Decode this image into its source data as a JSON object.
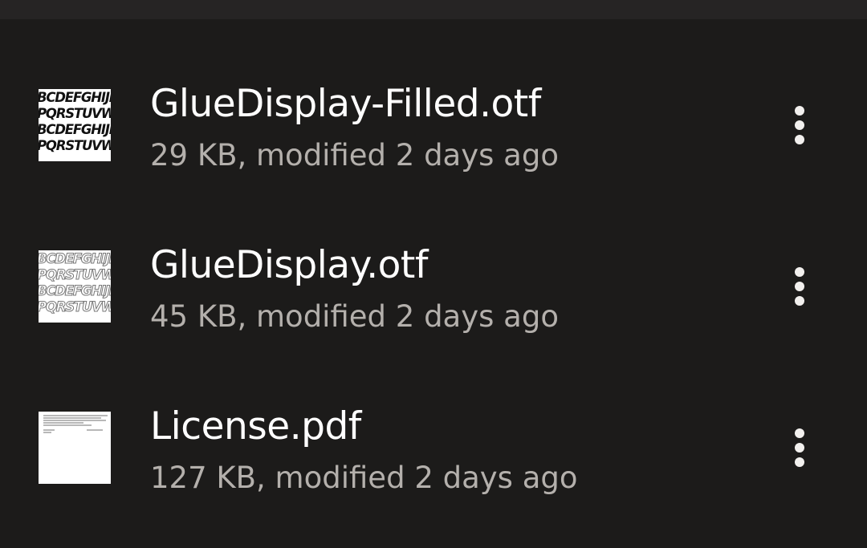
{
  "files": [
    {
      "name": "GlueDisplay-Filled.otf",
      "meta": "29 KB, modified 2 days ago",
      "thumbnail": "font-preview-filled",
      "preview_lines": [
        "BCDEFGHIJKLM",
        "PQRSTUVWXYZ",
        "BCDEFGHIJKLM",
        "PQRSTUVWXYZ"
      ]
    },
    {
      "name": "GlueDisplay.otf",
      "meta": "45 KB, modified 2 days ago",
      "thumbnail": "font-preview-outline",
      "preview_lines": [
        "BCDEFGHIJKLM",
        "PQRSTUVWXYZ",
        "BCDEFGHIJKLM",
        "PQRSTUVWXYZ"
      ]
    },
    {
      "name": "License.pdf",
      "meta": "127 KB, modified 2 days ago",
      "thumbnail": "pdf-page-preview"
    }
  ],
  "icons": {
    "more": "more-vertical-icon"
  },
  "colors": {
    "background": "#1c1b1a",
    "top_bar": "#262424",
    "name_text": "#ffffff",
    "meta_text": "#b4b0ac"
  }
}
